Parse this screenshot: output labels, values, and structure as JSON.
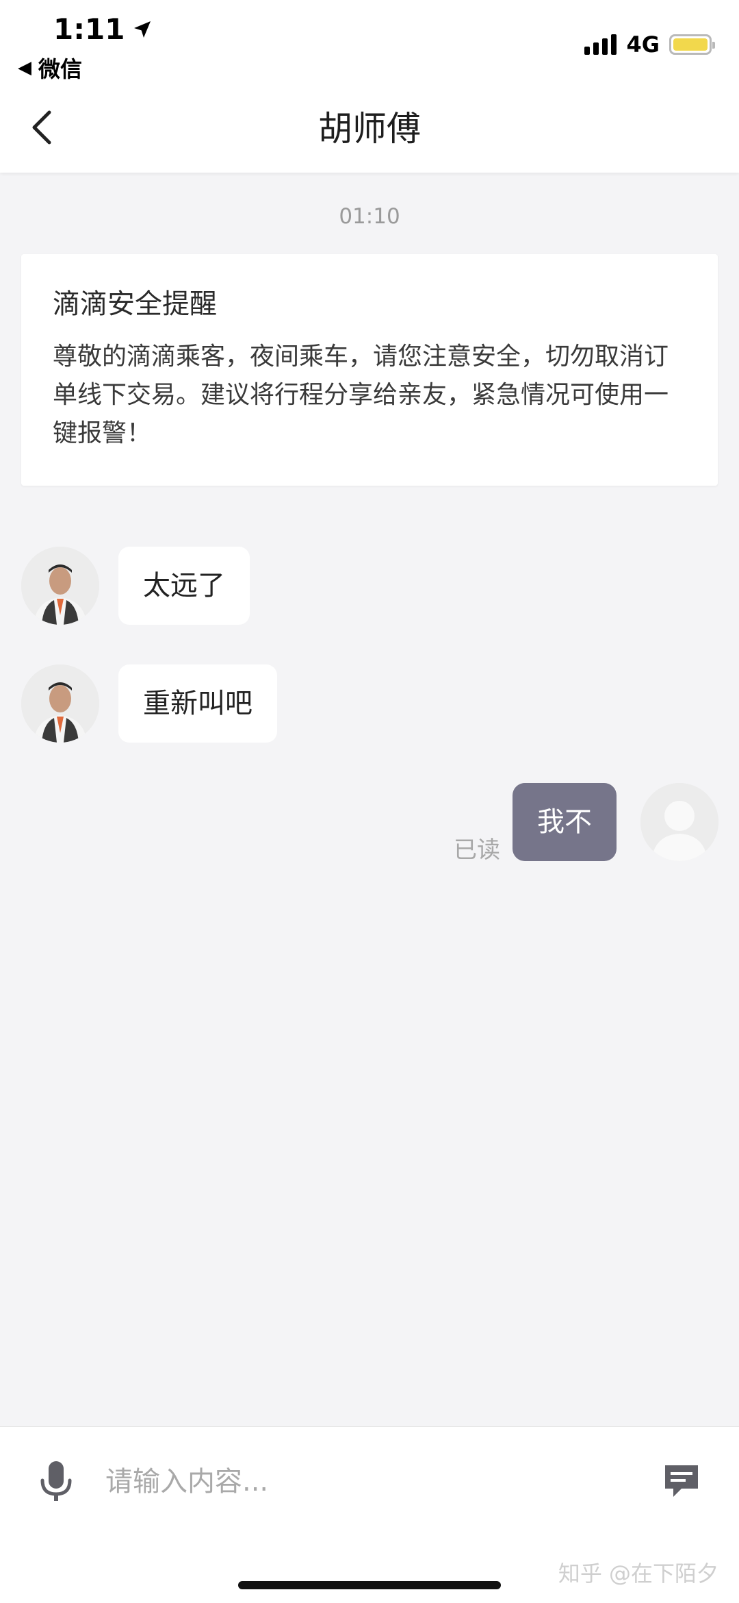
{
  "status_bar": {
    "time": "1:11",
    "back_app": "微信",
    "network": "4G"
  },
  "header": {
    "title": "胡师傅"
  },
  "chat": {
    "timestamp": "01:10",
    "notice": {
      "title": "滴滴安全提醒",
      "body": "尊敬的滴滴乘客，夜间乘车，请您注意安全，切勿取消订单线下交易。建议将行程分享给亲友，紧急情况可使用一键报警！"
    },
    "messages": [
      {
        "from": "driver",
        "text": "太远了"
      },
      {
        "from": "driver",
        "text": "重新叫吧"
      },
      {
        "from": "self",
        "text": "我不",
        "status": "已读"
      }
    ]
  },
  "input": {
    "placeholder": "请输入内容..."
  },
  "watermark": "知乎 @在下陌夕",
  "colors": {
    "outgoing_bubble": "#76758a",
    "battery": "#f2d84c",
    "background": "#f4f4f6"
  }
}
